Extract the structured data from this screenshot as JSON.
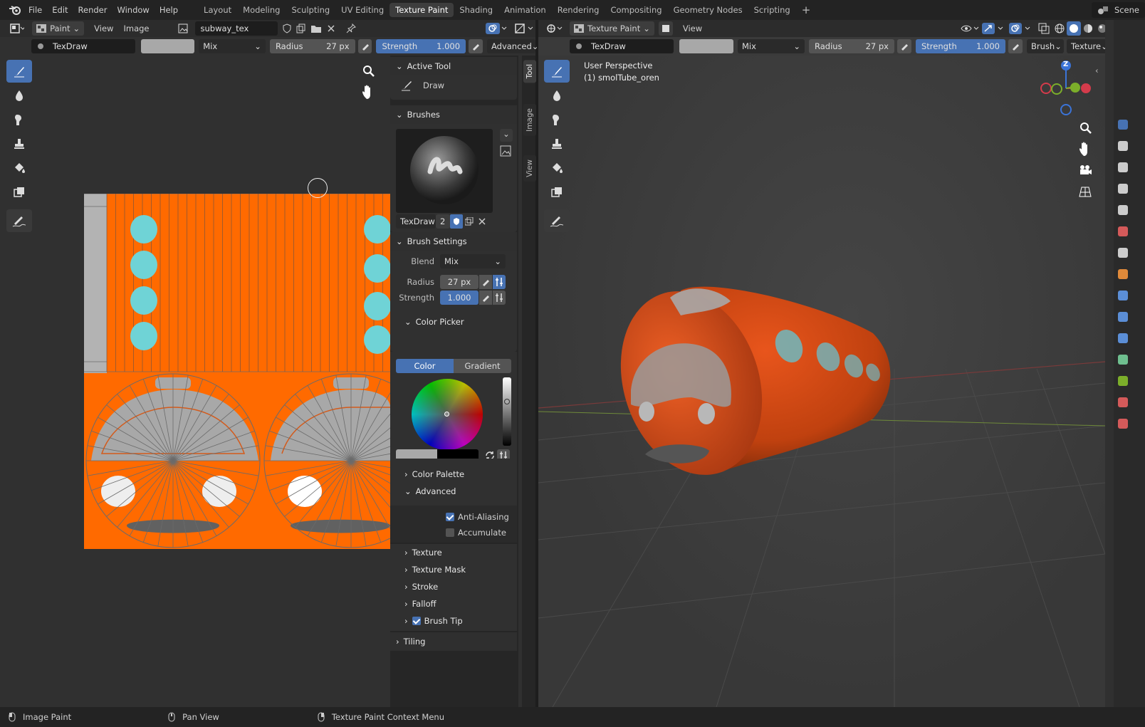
{
  "app": {
    "menus": [
      "File",
      "Edit",
      "Render",
      "Window",
      "Help"
    ],
    "workspaces": [
      "Layout",
      "Modeling",
      "Sculpting",
      "UV Editing",
      "Texture Paint",
      "Shading",
      "Animation",
      "Rendering",
      "Compositing",
      "Geometry Nodes",
      "Scripting"
    ],
    "active_workspace": "Texture Paint",
    "scene": "Scene"
  },
  "image_editor": {
    "mode": "Paint",
    "menu_view": "View",
    "menu_image": "Image",
    "image_name": "subway_tex",
    "toolbar": {
      "brush": "TexDraw",
      "blend": "Mix",
      "radius_label": "Radius",
      "radius_value": "27 px",
      "strength_label": "Strength",
      "strength_value": "1.000",
      "advanced": "Advanced"
    }
  },
  "sidebar": {
    "tabs": [
      "Tool",
      "Image",
      "View"
    ],
    "active_tool": {
      "title": "Active Tool",
      "name": "Draw"
    },
    "brushes": {
      "title": "Brushes",
      "name": "TexDraw",
      "users": "2"
    },
    "brush_settings": {
      "title": "Brush Settings",
      "blend_label": "Blend",
      "blend_value": "Mix",
      "radius_label": "Radius",
      "radius_value": "27 px",
      "strength_label": "Strength",
      "strength_value": "1.000"
    },
    "color_picker": {
      "title": "Color Picker",
      "tab_color": "Color",
      "tab_gradient": "Gradient"
    },
    "sections": {
      "color_palette": "Color Palette",
      "advanced": "Advanced",
      "anti_aliasing": "Anti-Aliasing",
      "accumulate": "Accumulate",
      "texture": "Texture",
      "texture_mask": "Texture Mask",
      "stroke": "Stroke",
      "falloff": "Falloff",
      "brush_tip": "Brush Tip",
      "tiling": "Tiling"
    }
  },
  "viewport": {
    "mode": "Texture Paint",
    "menu_view": "View",
    "perspective": "User Perspective",
    "object": "(1) smolTube_oren",
    "toolbar": {
      "brush": "TexDraw",
      "blend": "Mix",
      "radius_label": "Radius",
      "radius_value": "27 px",
      "strength_label": "Strength",
      "strength_value": "1.000",
      "brush_menu": "Brush",
      "texture_menu": "Texture"
    },
    "gizmo": {
      "z": "Z"
    }
  },
  "status": {
    "left": "Image Paint",
    "mid": "Pan View",
    "right": "Texture Paint Context Menu"
  },
  "colors": {
    "accent": "#4772b3",
    "orange": "#ff6a00",
    "cyan": "#6fd3d6",
    "background": "#1d1d1d"
  }
}
